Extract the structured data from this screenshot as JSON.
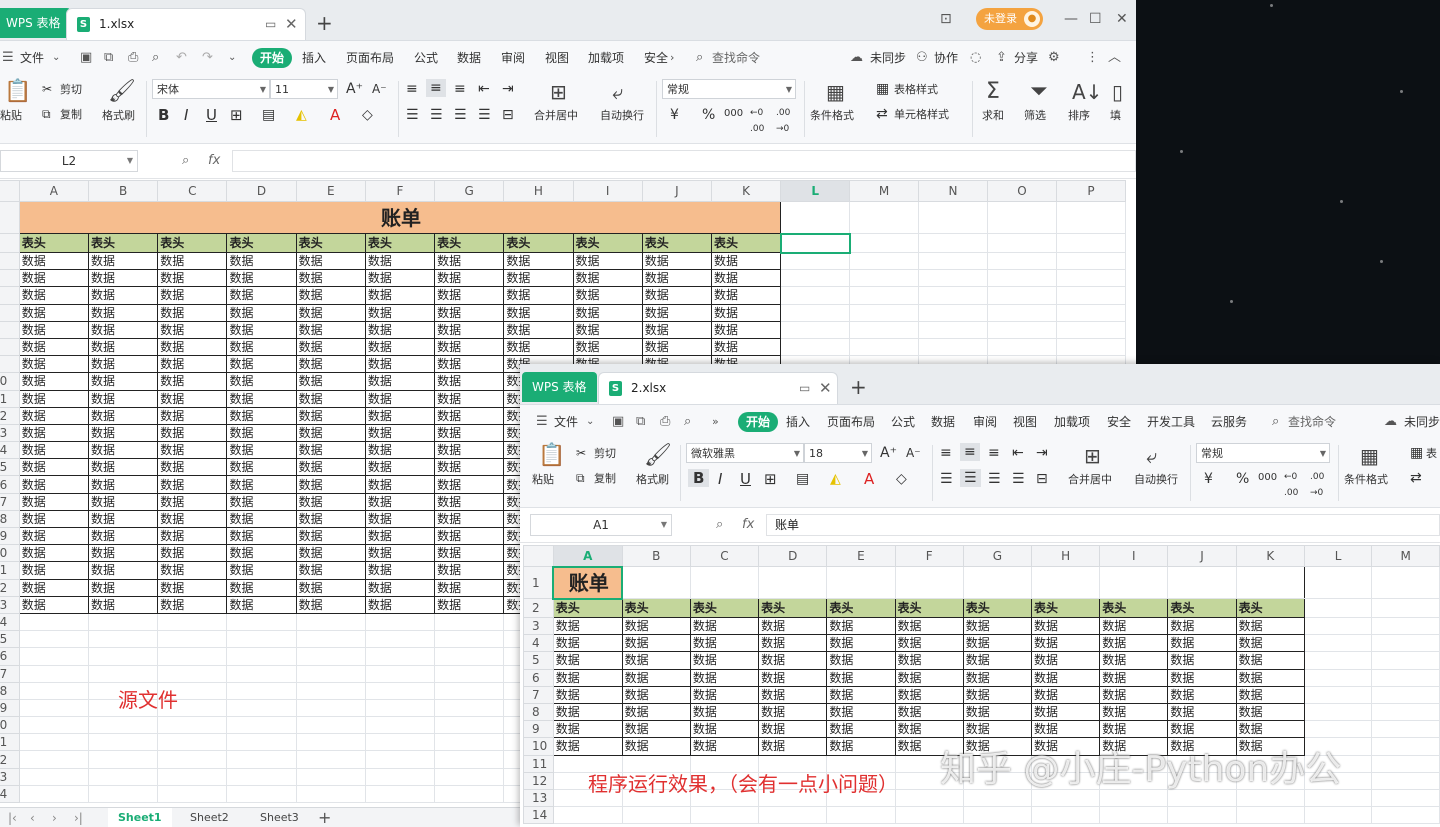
{
  "window1": {
    "app_tab": "WPS 表格",
    "file_tab": "1.xlsx",
    "login": "未登录",
    "menu": {
      "file": "文件",
      "items": [
        "开始",
        "插入",
        "页面布局",
        "公式",
        "数据",
        "审阅",
        "视图",
        "加载项",
        "安全"
      ],
      "active": "开始",
      "search": "查找命令",
      "sync": "未同步",
      "collab": "协作",
      "share": "分享"
    },
    "ribbon": {
      "paste": "粘贴",
      "cut": "剪切",
      "copy": "复制",
      "format_painter": "格式刷",
      "font": "宋体",
      "size": "11",
      "merge": "合并居中",
      "wrap": "自动换行",
      "numfmt": "常规",
      "cond_format": "条件格式",
      "table_style": "表格样式",
      "cell_style": "单元格样式",
      "sum": "求和",
      "filter": "筛选",
      "sort": "排序",
      "fill": "填"
    },
    "namebox": "L2",
    "formula": "",
    "columns": [
      "A",
      "B",
      "C",
      "D",
      "E",
      "F",
      "G",
      "H",
      "I",
      "J",
      "K",
      "L",
      "M",
      "N",
      "O",
      "P"
    ],
    "selected_col": "L",
    "selected_row": "2",
    "title": "账单",
    "header_text": "表头",
    "data_text": "数据",
    "rows_total": 34,
    "sheets": [
      "Sheet1",
      "Sheet2",
      "Sheet3"
    ],
    "active_sheet": "Sheet1"
  },
  "window2": {
    "app_tab": "WPS 表格",
    "file_tab": "2.xlsx",
    "menu": {
      "file": "文件",
      "items": [
        "开始",
        "插入",
        "页面布局",
        "公式",
        "数据",
        "审阅",
        "视图",
        "加载项",
        "安全",
        "开发工具",
        "云服务"
      ],
      "active": "开始",
      "search": "查找命令",
      "sync": "未同步"
    },
    "ribbon": {
      "paste": "粘贴",
      "cut": "剪切",
      "copy": "复制",
      "format_painter": "格式刷",
      "font": "微软雅黑",
      "size": "18",
      "merge": "合并居中",
      "wrap": "自动换行",
      "numfmt": "常规",
      "cond_format": "条件格式",
      "table_style": "表"
    },
    "namebox": "A1",
    "formula": "账单",
    "columns": [
      "A",
      "B",
      "C",
      "D",
      "E",
      "F",
      "G",
      "H",
      "I",
      "J",
      "K",
      "L",
      "M"
    ],
    "selected_col": "A",
    "title": "账单",
    "header_text": "表头",
    "data_text": "数据",
    "rows_total": 14
  },
  "annotations": {
    "source": "源文件",
    "result": "程序运行效果，（会有一点小问题）"
  },
  "watermark": "知乎 @小庄-Python办公",
  "colors": {
    "accent": "#1aad75",
    "title_fill": "#f6bd8e",
    "header_fill": "#c3d69b",
    "annotation": "#e03030",
    "login": "#f4a340"
  }
}
